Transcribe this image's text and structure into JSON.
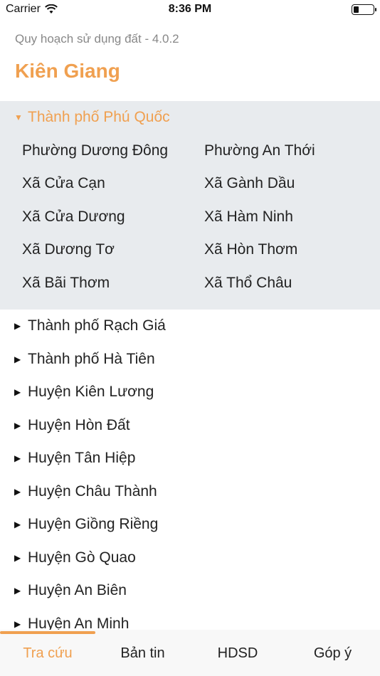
{
  "status_bar": {
    "carrier": "Carrier",
    "time": "8:36 PM",
    "battery_level": 0.25
  },
  "app": {
    "subtitle": "Quy hoạch sử dụng đất - 4.0.2",
    "province": "Kiên Giang"
  },
  "expanded_group": {
    "name": "Thành phố Phú Quốc",
    "wards": [
      "Phường Dương Đông",
      "Phường An Thới",
      "Xã Cửa Cạn",
      "Xã Gành Dầu",
      "Xã Cửa Dương",
      "Xã Hàm Ninh",
      "Xã Dương Tơ",
      "Xã Hòn Thơm",
      "Xã Bãi Thơm",
      "Xã Thổ Châu"
    ]
  },
  "groups": [
    "Thành phố Rạch Giá",
    "Thành phố Hà Tiên",
    "Huyện Kiên Lương",
    "Huyện Hòn Đất",
    "Huyện Tân Hiệp",
    "Huyện Châu Thành",
    "Huyện Giồng Riềng",
    "Huyện Gò Quao",
    "Huyện An Biên",
    "Huyện An Minh"
  ],
  "tabs": [
    "Tra cứu",
    "Bản tin",
    "HDSD",
    "Góp ý"
  ],
  "colors": {
    "accent": "#f0a050",
    "expanded_bg": "#e8ebee"
  }
}
